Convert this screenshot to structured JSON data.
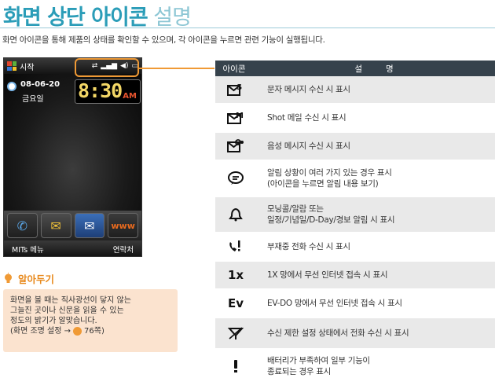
{
  "title": {
    "part1": "화면 상단 아이콘",
    "part2": "설명"
  },
  "intro": "화면 아이콘을 통해 제품의 상태를 확인할 수 있으며, 각 아이콘을 누르면 관련 기능이 실행됩니다.",
  "phone": {
    "start_label": "시작",
    "date": "08-06-20",
    "weekday": "금요일",
    "time": "8:30",
    "ampm": "AM",
    "softkey_left": "MITs 메뉴",
    "softkey_right": "연락처",
    "dock_apps": [
      "phone-app-icon",
      "message-app-icon",
      "email-app-icon",
      "www-app-icon"
    ]
  },
  "tip": {
    "heading": "알아두기",
    "line1": "화면을 볼 때는 직사광선이 닿지 않는",
    "line2": "그늘진 곳이나 신문을 읽을 수 있는",
    "line3": "정도의 밝기가 알맞습니다.",
    "line4_prefix": "(화면 조명 설정 →",
    "line4_page": "76쪽)"
  },
  "table": {
    "header_icon": "아이콘",
    "header_desc": "설명",
    "rows": [
      {
        "icon": "sms-icon",
        "desc1": "문자 메시지 수신 시 표시",
        "desc2": ""
      },
      {
        "icon": "shot-mail-icon",
        "desc1": "Shot 메일 수신 시 표시",
        "desc2": ""
      },
      {
        "icon": "voice-message-icon",
        "desc1": "음성 메시지 수신 시 표시",
        "desc2": ""
      },
      {
        "icon": "notification-icon",
        "desc1": "알림 상황이 여러 가지 있는 경우 표시",
        "desc2": "(아이콘을 누르면 알림 내용 보기)"
      },
      {
        "icon": "alarm-bell-icon",
        "desc1": "모닝콜/알람 또는",
        "desc2": "일정/기념일/D-Day/경보 알림 시 표시"
      },
      {
        "icon": "missed-call-icon",
        "desc1": "부재중 전화 수신 시 표시",
        "desc2": ""
      },
      {
        "icon": "1x-network-icon",
        "desc1": "1X 망에서 무선 인터넷 접속 시 표시",
        "desc2": ""
      },
      {
        "icon": "evdo-network-icon",
        "desc1": "EV-DO 망에서 무선 인터넷 접속 시 표시",
        "desc2": ""
      },
      {
        "icon": "call-restriction-icon",
        "desc1": "수신 제한 설정 상태에서 전화 수신 시 표시",
        "desc2": ""
      },
      {
        "icon": "low-battery-warning-icon",
        "desc1": "배터리가 부족하여 일부 기능이",
        "desc2": "종료되는 경우 표시"
      }
    ]
  }
}
